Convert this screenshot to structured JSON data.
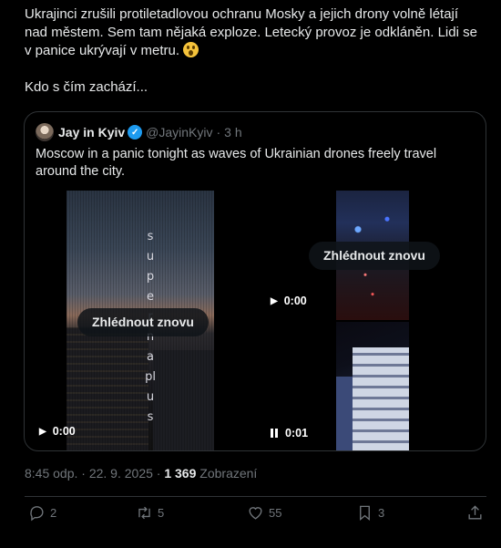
{
  "tweet": {
    "text_line1": "Ukrajinci zrušili protiletadlovou ochranu Mosky a jejich drony volně létají nad městem. Sem tam nějaká exploze. Letecký provoz je odkláněn. Lidi se v panice ukrývají v metru.",
    "emoji": "astonished-face",
    "text_line2": "Kdo s čím zachází..."
  },
  "quote": {
    "author_name": "Jay in Kyiv",
    "author_handle": "@JayinKyiv",
    "separator": "·",
    "time": "3 h",
    "text": "Moscow in a panic tonight as waves of Ukrainian drones freely travel around the city.",
    "media": [
      {
        "overlay_text": "superna plus",
        "replay_label": "Zhlédnout znovu",
        "time": "0:00",
        "state": "play"
      },
      {
        "replay_label": "Zhlédnout znovu",
        "time": "0:00",
        "state": "play"
      },
      {
        "time": "0:01",
        "state": "pause"
      }
    ]
  },
  "meta": {
    "timestamp": "8:45 odp. · 22. 9. 2025 ·",
    "views_count": "1 369",
    "views_label": "Zobrazení"
  },
  "actions": {
    "replies": "2",
    "reposts": "5",
    "likes": "55",
    "bookmarks": "3"
  },
  "colors": {
    "background": "#000000",
    "text": "#e7e9ea",
    "muted": "#71767b",
    "border": "#2f3336",
    "verified": "#1d9bf0"
  }
}
